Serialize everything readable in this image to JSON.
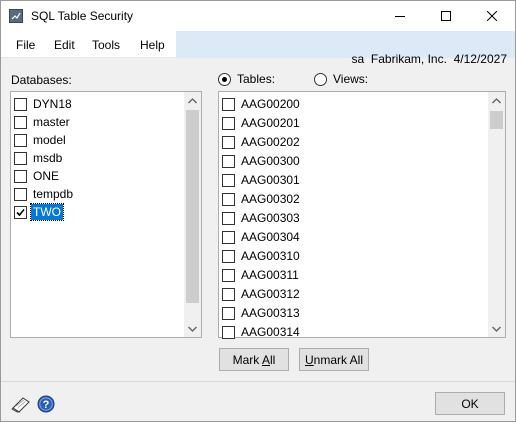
{
  "window": {
    "title": "SQL Table Security",
    "controls": {
      "minimize": "minimize-icon",
      "maximize": "maximize-icon",
      "close": "close-icon"
    }
  },
  "menu": {
    "items": [
      "File",
      "Edit",
      "Tools",
      "Help"
    ],
    "user": "sa",
    "company": "Fabrikam, Inc.",
    "date": "4/12/2027"
  },
  "databases": {
    "label": "Databases:",
    "items": [
      {
        "name": "DYN18",
        "checked": false,
        "selected": false
      },
      {
        "name": "master",
        "checked": false,
        "selected": false
      },
      {
        "name": "model",
        "checked": false,
        "selected": false
      },
      {
        "name": "msdb",
        "checked": false,
        "selected": false
      },
      {
        "name": "ONE",
        "checked": false,
        "selected": false
      },
      {
        "name": "tempdb",
        "checked": false,
        "selected": false
      },
      {
        "name": "TWO",
        "checked": true,
        "selected": true
      }
    ]
  },
  "view_mode": {
    "tables_label": "Tables:",
    "views_label": "Views:",
    "selected": "tables"
  },
  "tables": {
    "items": [
      "AAG00200",
      "AAG00201",
      "AAG00202",
      "AAG00300",
      "AAG00301",
      "AAG00302",
      "AAG00303",
      "AAG00304",
      "AAG00310",
      "AAG00311",
      "AAG00312",
      "AAG00313",
      "AAG00314"
    ]
  },
  "buttons": {
    "mark_all_prefix": "Mark ",
    "mark_all_key": "A",
    "mark_all_suffix": "ll",
    "unmark_all_key": "U",
    "unmark_all_suffix": "nmark All",
    "ok": "OK"
  },
  "footer_icons": [
    "note-icon",
    "help-icon"
  ],
  "colors": {
    "selection": "#0078d7",
    "menubar_band": "#dce9f7",
    "dialog_bg": "#f0f0f0"
  }
}
